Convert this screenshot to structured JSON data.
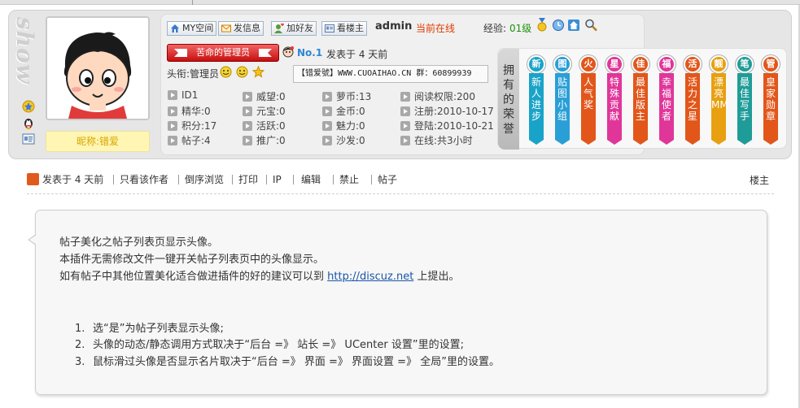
{
  "watermark": "show",
  "profile": {
    "nickname_label": "昵称:错爱",
    "toolbar": [
      {
        "label": "MY空间",
        "icon": "home-icon"
      },
      {
        "label": "发信息",
        "icon": "envelope-icon"
      },
      {
        "label": "加好友",
        "icon": "add-friend-icon"
      },
      {
        "label": "看楼主",
        "icon": "view-card-icon"
      }
    ],
    "username": "admin",
    "online_status": "当前在线",
    "exp_label": "经验:",
    "exp_level": "01级",
    "role_label": "苦命的管理员",
    "rank": "No.1",
    "posted": "发表于 4 天前",
    "head_title": "头衔:管理员",
    "banner": "【错爱號】WWW.CUOAIHAO.CN 群：60899939",
    "stats": [
      [
        "ID1",
        "威望:0",
        "萝币:13",
        "阅读权限:200"
      ],
      [
        "精华:0",
        "元宝:0",
        "金币:0",
        "注册:2010-10-17"
      ],
      [
        "积分:17",
        "活跃:0",
        "魅力:0",
        "登陆:2010-10-21"
      ],
      [
        "帖子:4",
        "推广:0",
        "沙发:0",
        "在线:共3小时"
      ]
    ],
    "honor_label": [
      "拥",
      "有",
      "的",
      "荣",
      "誉"
    ],
    "medals": [
      {
        "medal": "新",
        "text": "新人进步",
        "color": "#1aa3c8"
      },
      {
        "medal": "图",
        "text": "贴图小组",
        "color": "#2a9fd6"
      },
      {
        "medal": "火",
        "text": "人气奖",
        "color": "#e2561a"
      },
      {
        "medal": "星",
        "text": "特殊贡献",
        "color": "#e0369a"
      },
      {
        "medal": "佳",
        "text": "最佳版主",
        "color": "#e2561a"
      },
      {
        "medal": "福",
        "text": "幸福使者",
        "color": "#e0369a"
      },
      {
        "medal": "活",
        "text": "活力之星",
        "color": "#e2561a"
      },
      {
        "medal": "靓",
        "text": "漂亮MM",
        "color": "#e8a010"
      },
      {
        "medal": "笔",
        "text": "最佳写手",
        "color": "#1f9c98"
      },
      {
        "medal": "管",
        "text": "皇家勋章",
        "color": "#e2561a"
      }
    ]
  },
  "actions": {
    "items": [
      "发表于 4 天前",
      "只看该作者",
      "倒序浏览",
      "打印",
      "IP",
      "编辑",
      "禁止",
      "帖子"
    ],
    "floor": "楼主"
  },
  "post": {
    "line1": "帖子美化之帖子列表页显示头像。",
    "line2": "本插件无需修改文件一键开关帖子列表页中的头像显示。",
    "line3_prefix": "如有帖子中其他位置美化适合做进插件的好的建议可以到",
    "line3_link": "http://discuz.net",
    "line3_suffix": "上提出。",
    "list": [
      {
        "num": "1.",
        "text": "选“是”为帖子列表显示头像;"
      },
      {
        "num": "2.",
        "text": "头像的动态/静态调用方式取决于“后台 =》 站长 =》 UCenter 设置”里的设置;"
      },
      {
        "num": "3.",
        "text": "鼠标滑过头像是否显示名片取决于“后台 =》 界面 =》 界面设置 =》 全局”里的设置。"
      }
    ]
  }
}
